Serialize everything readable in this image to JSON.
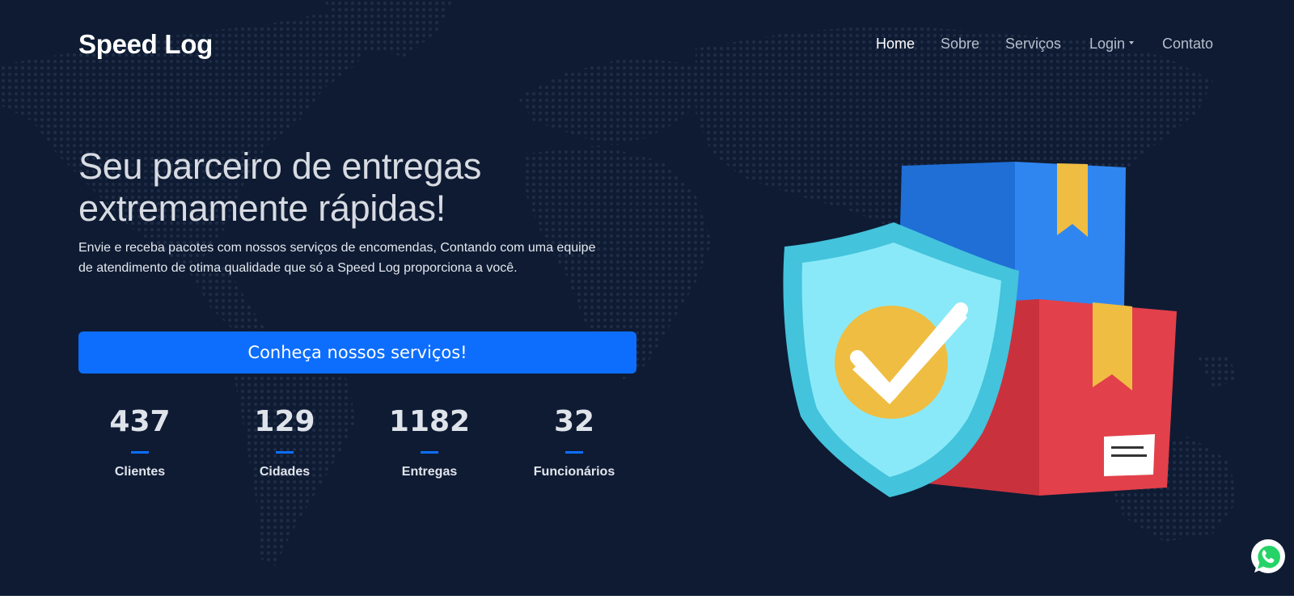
{
  "brand": {
    "name": "Speed Log"
  },
  "nav": {
    "items": [
      {
        "label": "Home",
        "active": true
      },
      {
        "label": "Sobre",
        "active": false
      },
      {
        "label": "Serviços",
        "active": false
      },
      {
        "label": "Login",
        "active": false,
        "dropdown": true
      },
      {
        "label": "Contato",
        "active": false
      }
    ]
  },
  "hero": {
    "headline_line1": "Seu parceiro de entregas",
    "headline_line2": "extremamente rápidas!",
    "subtext_line1": "Envie e receba pacotes com nossos serviços de encomendas, Contando com uma equipe",
    "subtext_line2": "de atendimento de otima qualidade que só a Speed Log proporciona a você.",
    "cta_label": "Conheça nossos serviços!"
  },
  "stats": [
    {
      "value": "437",
      "label": "Clientes"
    },
    {
      "value": "129",
      "label": "Cidades"
    },
    {
      "value": "1182",
      "label": "Entregas"
    },
    {
      "value": "32",
      "label": "Funcionários"
    }
  ],
  "icons": {
    "illustration": "shield-check-boxes-illustration",
    "floating": "whatsapp-icon"
  },
  "colors": {
    "background": "#0e1b33",
    "accent": "#0d6efd",
    "box_blue": "#2a7de6",
    "box_red": "#e2404a",
    "shield": "#43c3dc",
    "check_badge": "#efbd41",
    "whatsapp": "#25d366"
  }
}
